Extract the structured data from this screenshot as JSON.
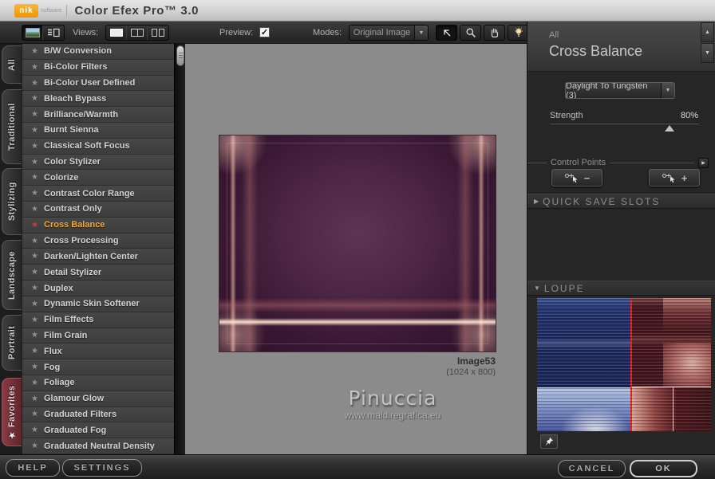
{
  "titlebar": {
    "logo_text": "nik",
    "logo_sub": "software",
    "title": "Color Efex Pro™ 3.0"
  },
  "toolbar": {
    "views_label": "Views:",
    "preview_label": "Preview:",
    "preview_checked": true,
    "modes_label": "Modes:",
    "modes_value": "Original Image"
  },
  "tabs": [
    {
      "label": "All"
    },
    {
      "label": "Traditional"
    },
    {
      "label": "Stylizing"
    },
    {
      "label": "Landscape"
    },
    {
      "label": "Portrait"
    },
    {
      "label": "Favorites",
      "accent": true,
      "starred": true
    }
  ],
  "filters": {
    "selected": "Cross Balance",
    "items": [
      {
        "label": "B/W Conversion"
      },
      {
        "label": "Bi-Color Filters"
      },
      {
        "label": "Bi-Color User Defined"
      },
      {
        "label": "Bleach Bypass"
      },
      {
        "label": "Brilliance/Warmth"
      },
      {
        "label": "Burnt Sienna"
      },
      {
        "label": "Classical Soft Focus"
      },
      {
        "label": "Color Stylizer"
      },
      {
        "label": "Colorize"
      },
      {
        "label": "Contrast Color Range"
      },
      {
        "label": "Contrast Only"
      },
      {
        "label": "Cross Balance",
        "selected": true
      },
      {
        "label": "Cross Processing"
      },
      {
        "label": "Darken/Lighten Center"
      },
      {
        "label": "Detail Stylizer"
      },
      {
        "label": "Duplex"
      },
      {
        "label": "Dynamic Skin Softener"
      },
      {
        "label": "Film Effects"
      },
      {
        "label": "Film Grain"
      },
      {
        "label": "Flux"
      },
      {
        "label": "Fog"
      },
      {
        "label": "Foliage"
      },
      {
        "label": "Glamour Glow"
      },
      {
        "label": "Graduated Filters"
      },
      {
        "label": "Graduated Fog"
      },
      {
        "label": "Graduated Neutral Density"
      }
    ]
  },
  "canvas": {
    "image_name": "Image53",
    "image_dimensions": "(1024 x 800)",
    "watermark_title": "Pinuccia",
    "watermark_url": "www.maidiregrafica.eu"
  },
  "panel": {
    "category": "All",
    "filter_name": "Cross Balance",
    "preset_value": "Daylight To Tungsten (3)",
    "strength_label": "Strength",
    "strength_value": "80%",
    "strength_percent": 80,
    "control_points_label": "Control Points",
    "quick_save_slots_label": "QUICK SAVE SLOTS",
    "loupe_label": "LOUPE"
  },
  "footer": {
    "help_label": "HELP",
    "settings_label": "SETTINGS",
    "cancel_label": "CANCEL",
    "ok_label": "OK"
  },
  "icons": {
    "filter_star": "★",
    "tab_star": "★",
    "checkbox_check": "✓",
    "dropdown_arrow": "▼",
    "scroll_up": "▲",
    "scroll_down": "▼",
    "section_collapsed": "▶",
    "section_expanded": "▼",
    "cp_expander": "▶",
    "cp_minus": "−",
    "cp_plus": "+"
  },
  "colors": {
    "accent_orange": "#f29a00",
    "selected_filter_text": "#f2a93c",
    "selected_star_red": "#c63c3c",
    "favorites_tab_red": "#7d333a",
    "canvas_gray": "#8b8b8b",
    "loupe_blue": "#1e2b60",
    "loupe_red": "#43141b",
    "loupe_divider_red": "#e62020"
  }
}
